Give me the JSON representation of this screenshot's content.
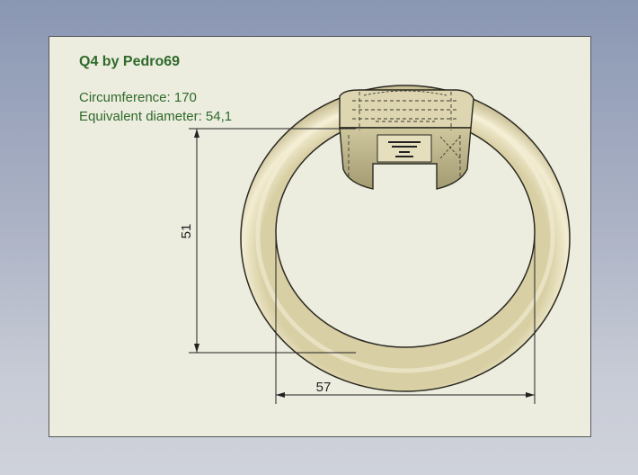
{
  "drawing": {
    "title": "Q4 by Pedro69",
    "circumference_label": "Circumference: 170",
    "diameter_label": "Equivalent diameter: 54,1",
    "dimension_height": "51",
    "dimension_width": "57"
  },
  "colors": {
    "background_top": "#8a97b3",
    "sheet": "#ececdf",
    "text_green": "#2f6a2a",
    "ring_fill": "#e3dcb6",
    "ring_edge": "#2a2a22",
    "dimension_line": "#222222"
  }
}
